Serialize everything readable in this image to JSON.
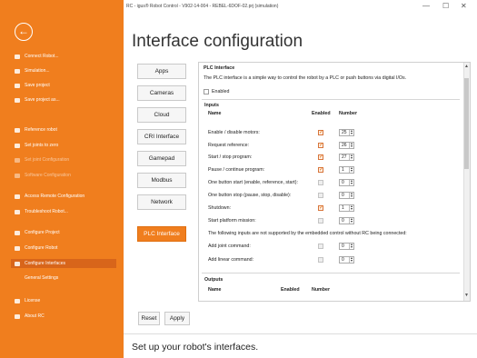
{
  "window": {
    "title": "RC - igus® Robot Control - V902-14-004 - REBEL-6DOF-02.prj (simulation)",
    "minimize": "—",
    "maximize": "☐",
    "close": "✕"
  },
  "sidebar": {
    "back_icon": "arrow-left-icon",
    "items": [
      {
        "label": "Connect Robot...",
        "state": "normal"
      },
      {
        "label": "Simulation...",
        "state": "normal"
      },
      {
        "label": "Save project",
        "state": "normal"
      },
      {
        "label": "Save project as...",
        "state": "normal"
      },
      {
        "label": "Reference robot",
        "state": "normal"
      },
      {
        "label": "Set joints to zero",
        "state": "normal"
      },
      {
        "label": "Set joint Configuration",
        "state": "dim"
      },
      {
        "label": "Software Configuration",
        "state": "dim"
      },
      {
        "label": "Access Remote Configuration",
        "state": "normal"
      },
      {
        "label": "Troubleshoot Robot...",
        "state": "normal"
      },
      {
        "label": "Configure Project",
        "state": "normal"
      },
      {
        "label": "Configure Robot",
        "state": "normal"
      },
      {
        "label": "Configure Interfaces",
        "state": "active"
      },
      {
        "label": "General Settings",
        "state": "sub"
      },
      {
        "label": "License",
        "state": "normal"
      },
      {
        "label": "About RC",
        "state": "normal"
      }
    ]
  },
  "page": {
    "title": "Interface configuration",
    "footer": "Set up your robot's interfaces."
  },
  "nav": [
    {
      "label": "Apps",
      "active": false
    },
    {
      "label": "Cameras",
      "active": false
    },
    {
      "label": "Cloud",
      "active": false
    },
    {
      "label": "CRI Interface",
      "active": false
    },
    {
      "label": "Gamepad",
      "active": false
    },
    {
      "label": "Modbus",
      "active": false
    },
    {
      "label": "Network",
      "active": false
    },
    {
      "label": "PLC Interface",
      "active": true
    }
  ],
  "plc": {
    "heading": "PLC Interface",
    "description": "The PLC interface is a simple way to control the robot by a PLC or push buttons via digital I/Os.",
    "enabled_label": "Enabled",
    "inputs_title": "Inputs",
    "col_name": "Name",
    "col_enabled": "Enabled",
    "col_number": "Number",
    "inputs": [
      {
        "name": "Enable / disable motors:",
        "enabled": true,
        "number": "25"
      },
      {
        "name": "Request reference:",
        "enabled": true,
        "number": "26"
      },
      {
        "name": "Start / stop program:",
        "enabled": true,
        "number": "27"
      },
      {
        "name": "Pause / continue program:",
        "enabled": true,
        "number": "1"
      },
      {
        "name": "One button start (enable, reference, start):",
        "enabled": false,
        "number": "0"
      },
      {
        "name": "One button stop (pause, stop, disable):",
        "enabled": false,
        "number": "0"
      },
      {
        "name": "Shutdown:",
        "enabled": true,
        "number": "1"
      },
      {
        "name": "Start platform mission:",
        "enabled": false,
        "number": "0"
      }
    ],
    "note": "The following inputs are not supported by the embedded control without RC being connected:",
    "extra_inputs": [
      {
        "name": "Add joint command:",
        "enabled": false,
        "number": "0"
      },
      {
        "name": "Add linear command:",
        "enabled": false,
        "number": "0"
      }
    ],
    "outputs_title": "Outputs"
  },
  "buttons": {
    "reset": "Reset",
    "apply": "Apply"
  }
}
